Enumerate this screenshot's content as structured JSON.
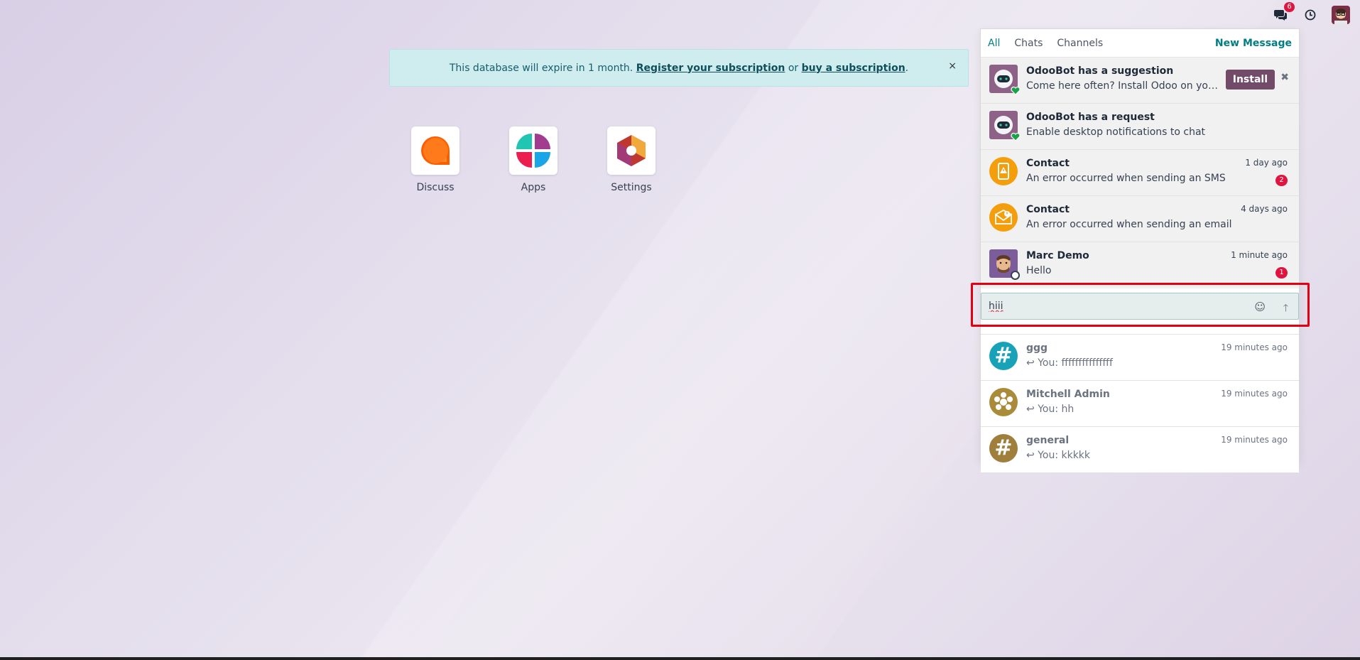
{
  "topnav": {
    "messages_badge": "6",
    "icons": [
      "chat-icon",
      "clock-icon",
      "user-avatar"
    ]
  },
  "banner": {
    "text_before": "This database will expire in 1 month.",
    "link1": "Register your subscription",
    "text_between": "or",
    "link2": "buy a subscription",
    "text_after": ".",
    "close": "×"
  },
  "apps": [
    {
      "label": "Discuss",
      "icon": "discuss-icon"
    },
    {
      "label": "Apps",
      "icon": "apps-icon"
    },
    {
      "label": "Settings",
      "icon": "settings-icon"
    }
  ],
  "panel": {
    "tabs": [
      "All",
      "Chats",
      "Channels"
    ],
    "active_tab": "All",
    "new_message": "New Message",
    "rows": [
      {
        "title": "OdooBot has a suggestion",
        "sub": "Come here often? Install Odoo on your de...",
        "button": "Install",
        "dismiss": "✖"
      },
      {
        "title": "OdooBot has a request",
        "sub": "Enable desktop notifications to chat"
      },
      {
        "title": "Contact",
        "sub": "An error occurred when sending an SMS",
        "time": "1 day ago",
        "count": "2"
      },
      {
        "title": "Contact",
        "sub": "An error occurred when sending an email",
        "time": "4 days ago"
      },
      {
        "title": "Marc Demo",
        "sub": "Hello",
        "time": "1 minute ago",
        "count": "1"
      }
    ],
    "composer": {
      "value": "hiii"
    },
    "read_rows": [
      {
        "title": "ggg",
        "sub": "You: fffffffffffffff",
        "time": "19 minutes ago"
      },
      {
        "title": "Mitchell Admin",
        "sub": "You: hh",
        "time": "19 minutes ago"
      },
      {
        "title": "general",
        "sub": "You: kkkkk",
        "time": "19 minutes ago"
      }
    ]
  },
  "colors": {
    "accent": "#017e84",
    "brand": "#714b67",
    "badge": "#e0153f",
    "highlight": "#e50011"
  }
}
